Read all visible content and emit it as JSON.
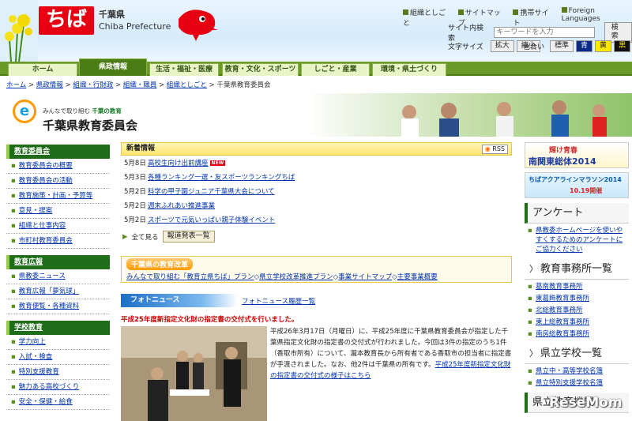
{
  "header": {
    "logo": "ちば",
    "title_ja": "千葉県",
    "title_en": "Chiba Prefecture",
    "util": [
      "組織としごと",
      "サイトマップ",
      "携帯サイト",
      "Foreign Languages"
    ],
    "search": {
      "label": "サイト内検索",
      "placeholder": "キーワードを入力",
      "button": "検索"
    },
    "textsize": {
      "label": "文字サイズ",
      "large": "拡大",
      "small": "縮小"
    },
    "color": {
      "label": "色合い",
      "standard": "標準",
      "blue": "青",
      "yellow": "黄",
      "black": "黒"
    }
  },
  "nav": [
    "ホーム",
    "県政情報",
    "生活・福祉・医療",
    "教育・文化・スポーツ",
    "しごと・産業",
    "環境・県土づくり"
  ],
  "breadcrumb": [
    "ホーム",
    "県政情報",
    "組織・行財政",
    "組織・職員",
    "組織としごと",
    "千葉県教育委員会"
  ],
  "banner": {
    "e": "e",
    "slogan_a": "みんなで取り組む",
    "slogan_b": "千葉の教育",
    "title": "千葉県教育委員会"
  },
  "left_nav": [
    {
      "head": "教育委員会",
      "items": [
        "教育委員会の概要",
        "教育委員会の活動",
        "教育施策・計画・予算等",
        "意見・提案",
        "組織と仕事内容",
        "市町村教育委員会"
      ]
    },
    {
      "head": "教育広報",
      "items": [
        "県教委ニュース",
        "教育広報「夢気球」",
        "教育便覧・各種資料"
      ]
    },
    {
      "head": "学校教育",
      "items": [
        "学力向上",
        "入試・検査",
        "特別支援教育",
        "魅力ある高校づくり",
        "安全・保健・給食"
      ]
    }
  ],
  "news": {
    "head": "新着情報",
    "rss": "RSS",
    "new_badge": "NEW",
    "items": [
      {
        "date": "5月8日",
        "title": "高校生向け出前講座"
      },
      {
        "date": "5月3日",
        "title": "各種ランキング一選・友スポーツランキングちば"
      },
      {
        "date": "5月2日",
        "title": "科学の甲子園ジュニア千葉県大会について"
      },
      {
        "date": "5月2日",
        "title": "週末ふれあい推進事業"
      },
      {
        "date": "5月2日",
        "title": "スポーツで元気いっぱい親子体験イベント"
      }
    ],
    "all": "全て見る",
    "press": "報道発表一覧"
  },
  "reform": {
    "title": "千葉県の教育改革",
    "links": [
      "みんなで取り組む「教育立県ちば」プラン",
      "県立学校改革推進プラン",
      "事業サイトマップ",
      "主要事業概要"
    ]
  },
  "photo": {
    "head": "フォトニュース",
    "history": "フォトニュース履歴一覧",
    "headline": "平成25年度新指定文化財の指定書の交付式を行いました。",
    "body": "平成26年3月17日（月曜日）に、平成25年度に千葉県教育委員会が指定した千葉県指定文化財の指定書の交付式が行われました。今回は3件の指定のうち1件（香取市所有）について、瀧本教育長から所有者である香取市の担当者に指定書が手渡されました。なお、他2件は千葉県の所有です。",
    "link": "平成25年度新指定文化財の指定書の交付式の様子はこちら"
  },
  "right": {
    "b1": "輝け青春",
    "b1b": "南関東総体2014",
    "b2": "ちばアクアラインマラソン2014",
    "b2b": "10.19開催",
    "anq": "アンケート",
    "anq_text": "県教委ホームページを使いやすくするためのアンケートにご協力ください",
    "office_head": "教育事務所一覧",
    "offices": [
      "葛南教育事務所",
      "東葛飾教育事務所",
      "北総教育事務所",
      "東上総教育事務所",
      "南房総教育事務所"
    ],
    "school_head": "県立学校一覧",
    "schools": [
      "県立中・高等学校名簿",
      "県立特別支援学校名簿"
    ],
    "overview": "県立教育機関"
  },
  "watermark": "ReseMom"
}
